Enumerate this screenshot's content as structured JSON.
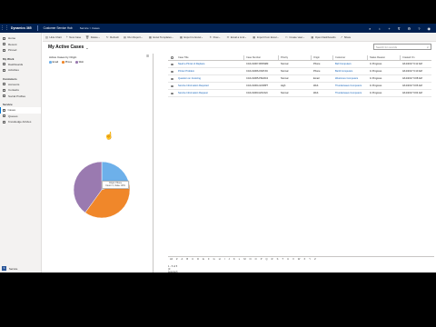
{
  "topbar": {
    "app_name": "Dynamics 365",
    "hub_name": "Customer Service Hub",
    "breadcrumb": "Service > Cases",
    "icons": [
      "search-icon",
      "lightbulb-icon",
      "plus-icon",
      "filter-icon",
      "gear-icon",
      "help-icon",
      "user-icon"
    ]
  },
  "sitemap": {
    "top_items": [
      {
        "label": "Home",
        "icon": "home-icon"
      },
      {
        "label": "Recent",
        "icon": "clock-icon"
      },
      {
        "label": "Pinned",
        "icon": "pin-icon"
      }
    ],
    "groups": [
      {
        "title": "My Work",
        "items": [
          {
            "label": "Dashboards",
            "active": false
          },
          {
            "label": "Activities",
            "active": false
          }
        ]
      },
      {
        "title": "Customers",
        "items": [
          {
            "label": "Accounts",
            "active": false
          },
          {
            "label": "Contacts",
            "active": false
          },
          {
            "label": "Social Profiles",
            "active": false
          }
        ]
      },
      {
        "title": "Service",
        "items": [
          {
            "label": "Cases",
            "active": true
          },
          {
            "label": "Queues",
            "active": false
          },
          {
            "label": "Knowledge Articles",
            "active": false
          }
        ]
      }
    ],
    "area_badge": "S",
    "area_label": "Service"
  },
  "commands": [
    {
      "icon": "chart-icon",
      "label": "Hide Chart"
    },
    {
      "icon": "plus-icon",
      "label": "New Case"
    },
    {
      "icon": "trash-icon",
      "label": "Delete"
    },
    {
      "icon": "refresh-icon",
      "label": "Refresh"
    },
    {
      "icon": "report-icon",
      "label": "Run Report"
    },
    {
      "icon": "excel-icon",
      "label": "Excel Templates"
    },
    {
      "icon": "export-icon",
      "label": "Export to Excel"
    },
    {
      "icon": "flow-icon",
      "label": "Flow"
    },
    {
      "icon": "email-icon",
      "label": "Email a Link"
    },
    {
      "icon": "import-icon",
      "label": "Import from Excel"
    },
    {
      "icon": "view-icon",
      "label": "Create view"
    },
    {
      "icon": "dashboard-icon",
      "label": "Open Dashboards"
    },
    {
      "icon": "share-icon",
      "label": "Share"
    }
  ],
  "view": {
    "title": "My Active Cases",
    "search_placeholder": "Search for records"
  },
  "chart": {
    "title": "Active Cases by Origin",
    "tooltip_line1": "Origin: Phone",
    "tooltip_line2": "Count: 2, Value: 40%",
    "legend": [
      {
        "label": "Email",
        "color": "#6db0ea"
      },
      {
        "label": "Phone",
        "color": "#f0872a"
      },
      {
        "label": "Web",
        "color": "#9a7ab0"
      }
    ]
  },
  "chart_data": {
    "type": "pie",
    "title": "Active Cases by Origin",
    "categories": [
      "Email",
      "Phone",
      "Web"
    ],
    "values": [
      1,
      2,
      2
    ],
    "colors": [
      "#6db0ea",
      "#f0872a",
      "#9a7ab0"
    ]
  },
  "grid": {
    "columns": [
      "Case Title",
      "Case Number",
      "Priority",
      "Origin",
      "Customer",
      "Status Reason",
      "Created On"
    ],
    "rows": [
      [
        "Need a Printer & Replace",
        "CAS-01007-R8X9M3",
        "Normal",
        "Phone",
        "Bell Computers",
        "In Progress",
        "4/12/2017 9:12 AM"
      ],
      [
        "Printer Problem",
        "CAS-01006-K6Z7A9",
        "Normal",
        "Phone",
        "Bertil Computers",
        "In Progress",
        "4/12/2017 9:10 AM"
      ],
      [
        "Question on Invoicing",
        "CAS-01005-P9H6C2",
        "Normal",
        "Email",
        "Westmore Computers",
        "In Progress",
        "4/12/2017 9:08 AM"
      ],
      [
        "Service Information Required",
        "CAS-01004-G6X8P7",
        "High",
        "Web",
        "Thunderwave Computers",
        "In Progress",
        "4/12/2017 9:06 AM"
      ],
      [
        "Service Information Request",
        "CAS-01003-H9V4L6",
        "Normal",
        "Web",
        "Thunderwave Computers",
        "In Progress",
        "4/12/2017 9:04 AM"
      ]
    ]
  },
  "alphabar": [
    "All",
    "#",
    "A",
    "B",
    "C",
    "D",
    "E",
    "F",
    "G",
    "H",
    "I",
    "J",
    "K",
    "L",
    "M",
    "N",
    "O",
    "P",
    "Q",
    "R",
    "S",
    "T",
    "U",
    "V",
    "W",
    "X",
    "Y",
    "Z"
  ],
  "footer": "1 - 5 of 5 (0 selected)"
}
